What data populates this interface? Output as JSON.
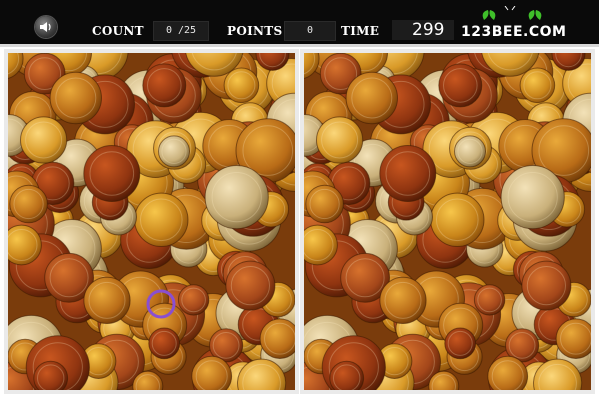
{
  "header": {
    "count_label": "COUNT",
    "count_value": "0 /25",
    "points_label": "POINTS",
    "points_value": "0",
    "time_label": "TIME",
    "time_value": "299",
    "logo_text": "123BEE.COM",
    "sound_icon": "speaker-icon",
    "logo_icon": "bee-icon"
  },
  "colors": {
    "header_bg": "#0a0a0a",
    "marker": "#8a4fd0",
    "coin_gold": "#e09a1c",
    "coin_copper": "#b5561f",
    "coin_silver": "#d9cdb4"
  },
  "game": {
    "left_panel": "original-image",
    "right_panel": "modified-image",
    "found_marker_shown": true
  }
}
